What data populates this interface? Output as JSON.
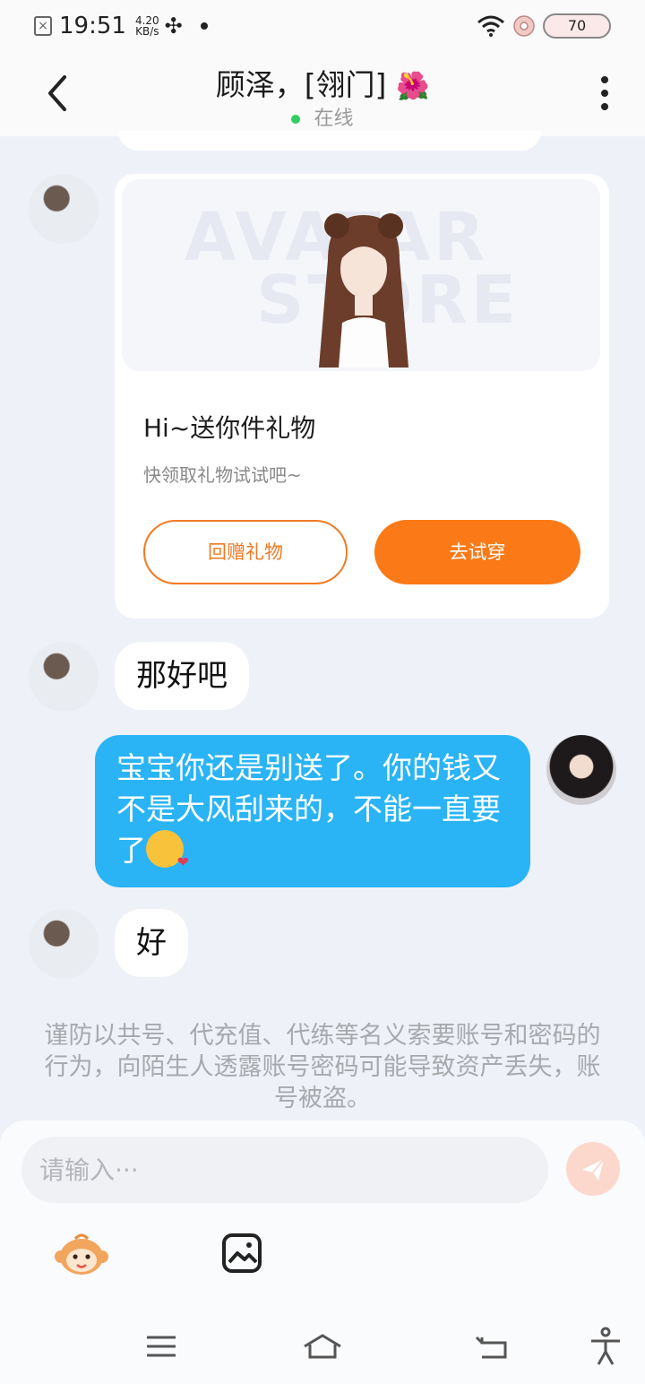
{
  "status_bar": {
    "time": "19:51",
    "net_speed_value": "4.20",
    "net_speed_unit": "KB/s",
    "battery": "70"
  },
  "header": {
    "title": "顾泽，[翎门]",
    "status": "在线"
  },
  "gift_card": {
    "watermark_line1": "AVATAR",
    "watermark_line2": "STORE",
    "title": "Hi~送你件礼物",
    "subtitle": "快领取礼物试试吧~",
    "return_gift_label": "回赠礼物",
    "try_on_label": "去试穿"
  },
  "messages": [
    {
      "side": "left",
      "text": "那好吧"
    },
    {
      "side": "right",
      "text": " 宝宝你还是别送了。你的钱又不是大风刮来的，不能一直要了"
    },
    {
      "side": "left",
      "text": "好"
    }
  ],
  "notice": "谨防以共号、代充值、代练等名义索要账号和密码的行为，向陌生人透露账号密码可能导致资产丢失，账号被盗。",
  "input": {
    "placeholder": "请输入···"
  },
  "colors": {
    "accent_orange": "#fb7a17",
    "bubble_blue": "#2ab4f6",
    "online_green": "#2fcf5f"
  },
  "icons": [
    "back-arrow-icon",
    "more-vertical-icon",
    "hibiscus-icon",
    "send-icon",
    "monkey-emoji-icon",
    "image-icon",
    "menu-icon",
    "home-icon",
    "back-icon",
    "accessibility-icon"
  ]
}
